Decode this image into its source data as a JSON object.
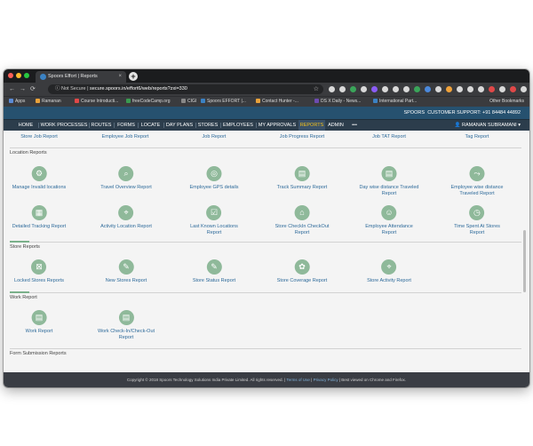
{
  "browser": {
    "tab_title": "Spoors Effort | Reports",
    "security_label": "Not Secure",
    "url": "secure.spoors.in/effort6/web/reports?zxi=330",
    "new_tab_label": "+",
    "close_label": "×",
    "bookmarks": [
      {
        "label": "Apps",
        "color": "#5b8bd6"
      },
      {
        "label": "Ramanan",
        "color": "#e9a23b"
      },
      {
        "label": "Course Introducti...",
        "color": "#e04848"
      },
      {
        "label": "freeCodeCamp.org",
        "color": "#3a9a50"
      },
      {
        "label": "CIGI",
        "color": "#888888"
      },
      {
        "label": "Spoors EFFORT |...",
        "color": "#3b82c4"
      },
      {
        "label": "Contact Hunter -...",
        "color": "#e9a23b"
      },
      {
        "label": "DS X Daily - News...",
        "color": "#6d4bb0"
      },
      {
        "label": "International Part...",
        "color": "#3b82c4"
      }
    ],
    "other_bookmarks": "Other Bookmarks"
  },
  "app": {
    "brand": "SPOORS",
    "support": "CUSTOMER SUPPORT: +91 84484 44892",
    "user": "RAMANAN SUBRAMANI",
    "nav": [
      {
        "label": "HOME",
        "active": false
      },
      {
        "label": "WORK PROCESSES",
        "active": false
      },
      {
        "label": "ROUTES",
        "active": false
      },
      {
        "label": "FORMS",
        "active": false
      },
      {
        "label": "LOCATE",
        "active": false
      },
      {
        "label": "DAY PLANS",
        "active": false
      },
      {
        "label": "STORES",
        "active": false
      },
      {
        "label": "EMPLOYEES",
        "active": false
      },
      {
        "label": "MY APPROVALS",
        "active": false
      },
      {
        "label": "REPORTS",
        "active": true
      },
      {
        "label": "ADMIN",
        "active": false
      },
      {
        "label": "•••",
        "active": false
      }
    ]
  },
  "reports": {
    "top_row": [
      "Store Job Report",
      "Employee Job Report",
      "Job Report",
      "Job Progress Report",
      "Job TAT Report",
      "Tag Report"
    ],
    "location_title": "Location Reports",
    "location_row1": [
      {
        "label": "Manage Invalid locations",
        "icon": "gear-icon"
      },
      {
        "label": "Travel Overview Report",
        "icon": "magnifier-icon"
      },
      {
        "label": "Employee GPS details",
        "icon": "gps-icon"
      },
      {
        "label": "Track Summary Report",
        "icon": "document-icon"
      },
      {
        "label": "Day wise distance Traveled",
        "label2": "Report",
        "icon": "document-icon"
      },
      {
        "label": "Employee wise distance",
        "label2": "Traveled Report",
        "icon": "route-icon"
      }
    ],
    "location_row2": [
      {
        "label": "Detailed Tracking Report",
        "icon": "clipboard-icon"
      },
      {
        "label": "Activity Location Report",
        "icon": "pin-icon"
      },
      {
        "label": "Last Known Locations",
        "label2": "Report",
        "icon": "checklist-icon"
      },
      {
        "label": "Store CheckIn CheckOut",
        "label2": "Report",
        "icon": "store-icon"
      },
      {
        "label": "Employee Attendance",
        "label2": "Report",
        "icon": "user-icon"
      },
      {
        "label": "Time Spent At Stores",
        "label2": "Report",
        "icon": "clock-icon"
      }
    ],
    "store_title": "Store Reports",
    "store_row": [
      {
        "label": "Locked Stores Reports",
        "icon": "lock-icon"
      },
      {
        "label": "New Stores Report",
        "icon": "edit-icon"
      },
      {
        "label": "Store Status Report",
        "icon": "edit-icon"
      },
      {
        "label": "Store Coverage Report",
        "icon": "coverage-icon"
      },
      {
        "label": "Store Activity Report",
        "icon": "pin-icon"
      }
    ],
    "work_title": "Work Report",
    "work_row": [
      {
        "label": "Work Report",
        "icon": "document-icon"
      },
      {
        "label": "Work Check-In/Check-Out",
        "label2": "Report",
        "icon": "document-icon"
      }
    ],
    "form_title": "Form Submission Reports"
  },
  "footer": {
    "copyright": "Copyright © 2018 Spoors Technology Solutions India Private Limited. All rights reserved.",
    "terms": "Terms of Use",
    "privacy": "Privacy Policy",
    "best_viewed": "Best viewed on Chrome and Firefox."
  }
}
